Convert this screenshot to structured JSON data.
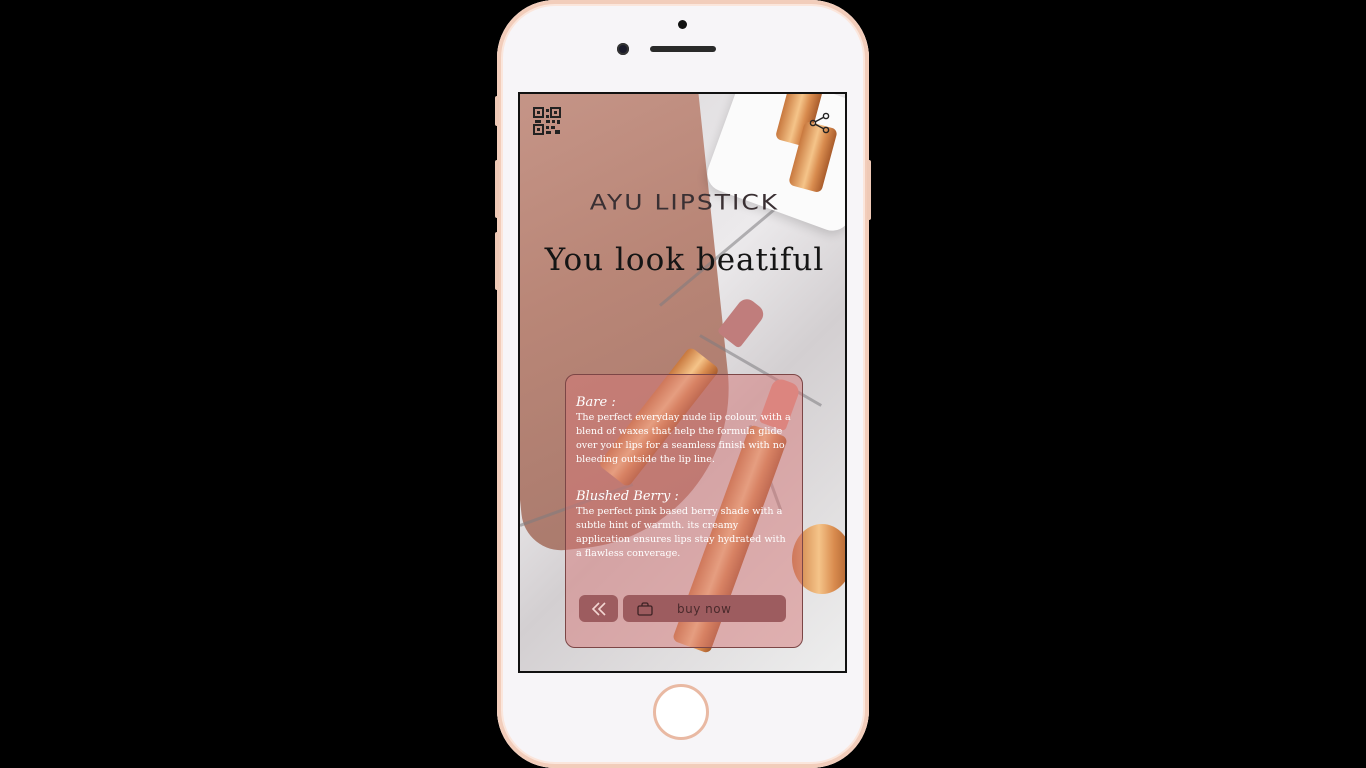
{
  "app": {
    "brand": "AYU LIPSTICK",
    "tagline": "You look beatiful"
  },
  "icons": {
    "qr": "qr-code-icon",
    "share": "share-icon",
    "back": "double-chevron-left-icon",
    "bag": "shopping-bag-icon"
  },
  "shades": [
    {
      "name": "Bare :",
      "description": "The perfect everyday nude lip colour, with a blend of waxes that help the formula glide over your lips for a seamless finish with no bleeding outside the lip line."
    },
    {
      "name": "Blushed Berry :",
      "description": "The perfect pink based berry shade with a subtle hint of warmth. its creamy application ensures lips stay hydrated with a flawless converage."
    }
  ],
  "actions": {
    "buy_label": "buy now"
  },
  "colors": {
    "card": "#d67878",
    "button": "#9d5c5f",
    "phone_frame": "#f2cdbb"
  }
}
